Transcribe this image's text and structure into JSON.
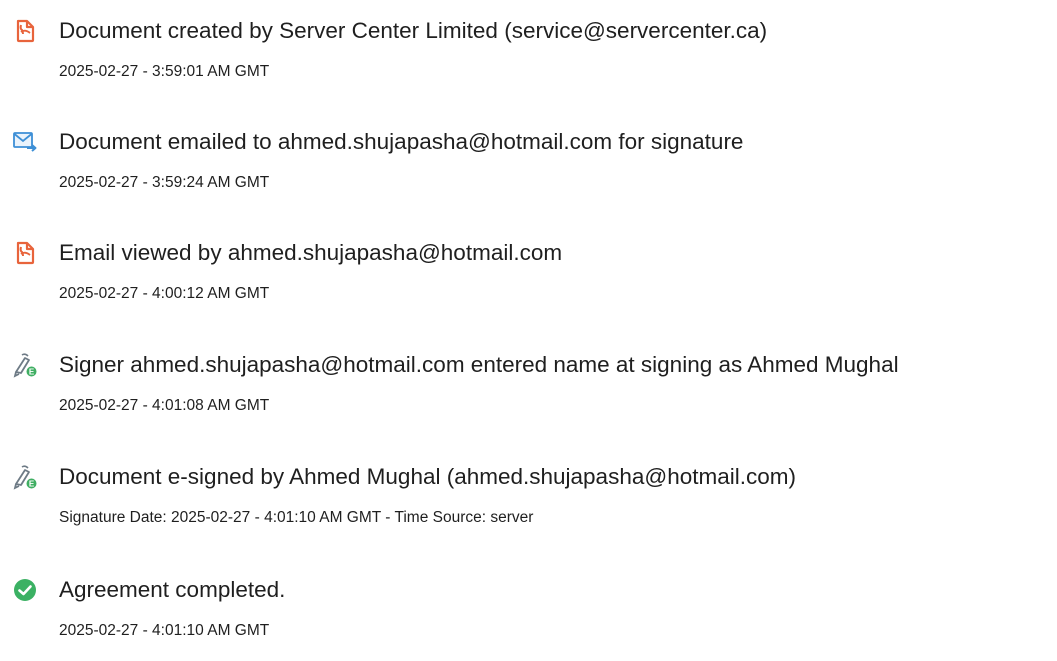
{
  "colors": {
    "pdf_icon": "#e8643c",
    "email_icon": "#3d8fd6",
    "sign_icon": "#6e7b86",
    "sign_badge": "#3fae62",
    "complete_icon": "#3bb163",
    "text": "#1f1f1f"
  },
  "events": [
    {
      "icon": "document-created-icon",
      "title": "Document created by Server Center Limited (service@servercenter.ca)",
      "meta": "2025-02-27 - 3:59:01 AM GMT"
    },
    {
      "icon": "email-sent-icon",
      "title": "Document emailed to ahmed.shujapasha@hotmail.com for signature",
      "meta": "2025-02-27 - 3:59:24 AM GMT"
    },
    {
      "icon": "document-viewed-icon",
      "title": "Email viewed by ahmed.shujapasha@hotmail.com",
      "meta": "2025-02-27 - 4:00:12 AM GMT"
    },
    {
      "icon": "signer-pen-icon",
      "title": "Signer ahmed.shujapasha@hotmail.com entered name at signing as Ahmed Mughal",
      "meta": "2025-02-27 - 4:01:08 AM GMT"
    },
    {
      "icon": "esign-pen-icon",
      "title": "Document e-signed by Ahmed Mughal (ahmed.shujapasha@hotmail.com)",
      "meta": "Signature Date: 2025-02-27 - 4:01:10 AM GMT - Time Source: server"
    },
    {
      "icon": "check-circle-icon",
      "title": "Agreement completed.",
      "meta": "2025-02-27 - 4:01:10 AM GMT"
    }
  ]
}
